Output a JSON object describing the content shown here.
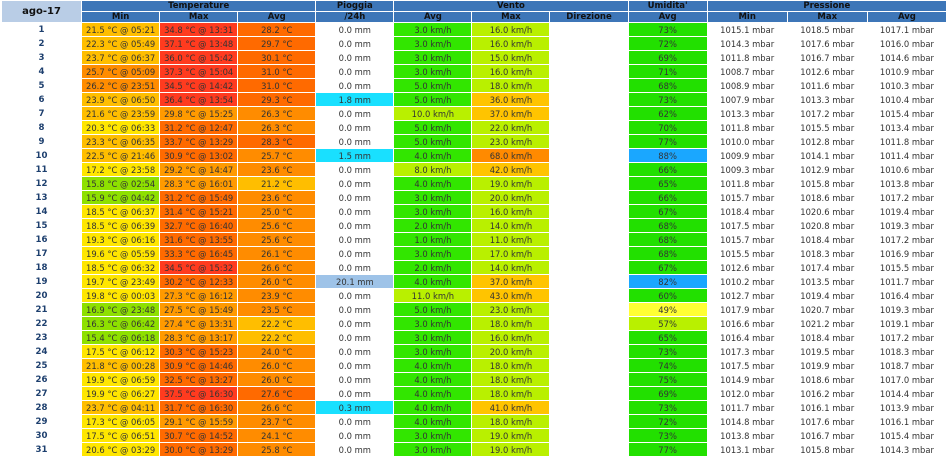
{
  "header": {
    "month": "ago-17",
    "groups": {
      "temperature": "Temperature",
      "rain": "Pioggia",
      "wind": "Vento",
      "humidity": "Umidita'",
      "pressure": "Pressione"
    },
    "sub": {
      "t_min": "Min",
      "t_max": "Max",
      "t_avg": "Avg",
      "rain": "/24h",
      "w_avg": "Avg",
      "w_max": "Max",
      "w_dir": "Direzione",
      "h_avg": "Avg",
      "p_min": "Min",
      "p_max": "Max",
      "p_avg": "Avg"
    }
  },
  "rows": [
    {
      "day": "1",
      "tmin": "21.5 °C @ 05:21",
      "tmax": "34.8 °C @ 13:31",
      "tavg": "28.2 °C",
      "rain": "0.0 mm",
      "wavg": "3.0 km/h",
      "wmax": "16.0 km/h",
      "wdir": "",
      "hum": "73%",
      "pmin": "1015.1 mbar",
      "pmax": "1018.5 mbar",
      "pavg": "1017.1 mbar"
    },
    {
      "day": "2",
      "tmin": "22.3 °C @ 05:49",
      "tmax": "37.1 °C @ 13:48",
      "tavg": "29.7 °C",
      "rain": "0.0 mm",
      "wavg": "3.0 km/h",
      "wmax": "16.0 km/h",
      "wdir": "",
      "hum": "72%",
      "pmin": "1014.3 mbar",
      "pmax": "1017.6 mbar",
      "pavg": "1016.0 mbar"
    },
    {
      "day": "3",
      "tmin": "23.7 °C @ 06:37",
      "tmax": "36.0 °C @ 15:42",
      "tavg": "30.1 °C",
      "rain": "0.0 mm",
      "wavg": "3.0 km/h",
      "wmax": "15.0 km/h",
      "wdir": "",
      "hum": "69%",
      "pmin": "1011.8 mbar",
      "pmax": "1016.7 mbar",
      "pavg": "1014.6 mbar"
    },
    {
      "day": "4",
      "tmin": "25.7 °C @ 05:09",
      "tmax": "37.3 °C @ 15:04",
      "tavg": "31.0 °C",
      "rain": "0.0 mm",
      "wavg": "3.0 km/h",
      "wmax": "16.0 km/h",
      "wdir": "",
      "hum": "71%",
      "pmin": "1008.7 mbar",
      "pmax": "1012.6 mbar",
      "pavg": "1010.9 mbar"
    },
    {
      "day": "5",
      "tmin": "26.2 °C @ 23:51",
      "tmax": "34.5 °C @ 14:42",
      "tavg": "31.0 °C",
      "rain": "0.0 mm",
      "wavg": "5.0 km/h",
      "wmax": "18.0 km/h",
      "wdir": "",
      "hum": "68%",
      "pmin": "1008.9 mbar",
      "pmax": "1011.6 mbar",
      "pavg": "1010.3 mbar"
    },
    {
      "day": "6",
      "tmin": "23.9 °C @ 06:50",
      "tmax": "36.4 °C @ 13:54",
      "tavg": "29.3 °C",
      "rain": "1.8 mm",
      "wavg": "5.0 km/h",
      "wmax": "36.0 km/h",
      "wdir": "",
      "hum": "73%",
      "pmin": "1007.9 mbar",
      "pmax": "1013.3 mbar",
      "pavg": "1010.4 mbar"
    },
    {
      "day": "7",
      "tmin": "21.6 °C @ 23:59",
      "tmax": "29.8 °C @ 15:25",
      "tavg": "26.3 °C",
      "rain": "0.0 mm",
      "wavg": "10.0 km/h",
      "wmax": "37.0 km/h",
      "wdir": "",
      "hum": "62%",
      "pmin": "1013.3 mbar",
      "pmax": "1017.2 mbar",
      "pavg": "1015.4 mbar"
    },
    {
      "day": "8",
      "tmin": "20.3 °C @ 06:33",
      "tmax": "31.2 °C @ 12:47",
      "tavg": "26.3 °C",
      "rain": "0.0 mm",
      "wavg": "5.0 km/h",
      "wmax": "22.0 km/h",
      "wdir": "",
      "hum": "70%",
      "pmin": "1011.8 mbar",
      "pmax": "1015.5 mbar",
      "pavg": "1013.4 mbar"
    },
    {
      "day": "9",
      "tmin": "23.3 °C @ 06:35",
      "tmax": "33.7 °C @ 13:29",
      "tavg": "28.3 °C",
      "rain": "0.0 mm",
      "wavg": "5.0 km/h",
      "wmax": "23.0 km/h",
      "wdir": "",
      "hum": "77%",
      "pmin": "1010.0 mbar",
      "pmax": "1012.8 mbar",
      "pavg": "1011.8 mbar"
    },
    {
      "day": "10",
      "tmin": "22.5 °C @ 21:46",
      "tmax": "30.9 °C @ 13:02",
      "tavg": "25.7 °C",
      "rain": "1.5 mm",
      "wavg": "4.0 km/h",
      "wmax": "68.0 km/h",
      "wdir": "",
      "hum": "88%",
      "pmin": "1009.9 mbar",
      "pmax": "1014.1 mbar",
      "pavg": "1011.4 mbar"
    },
    {
      "day": "11",
      "tmin": "17.2 °C @ 23:58",
      "tmax": "29.2 °C @ 14:47",
      "tavg": "23.6 °C",
      "rain": "0.0 mm",
      "wavg": "8.0 km/h",
      "wmax": "42.0 km/h",
      "wdir": "",
      "hum": "66%",
      "pmin": "1009.3 mbar",
      "pmax": "1012.9 mbar",
      "pavg": "1010.6 mbar"
    },
    {
      "day": "12",
      "tmin": "15.8 °C @ 02:54",
      "tmax": "28.3 °C @ 16:01",
      "tavg": "21.2 °C",
      "rain": "0.0 mm",
      "wavg": "4.0 km/h",
      "wmax": "19.0 km/h",
      "wdir": "",
      "hum": "65%",
      "pmin": "1011.8 mbar",
      "pmax": "1015.8 mbar",
      "pavg": "1013.8 mbar"
    },
    {
      "day": "13",
      "tmin": "15.9 °C @ 04:42",
      "tmax": "31.2 °C @ 15:49",
      "tavg": "23.6 °C",
      "rain": "0.0 mm",
      "wavg": "3.0 km/h",
      "wmax": "20.0 km/h",
      "wdir": "",
      "hum": "66%",
      "pmin": "1015.7 mbar",
      "pmax": "1018.6 mbar",
      "pavg": "1017.2 mbar"
    },
    {
      "day": "14",
      "tmin": "18.5 °C @ 06:37",
      "tmax": "31.4 °C @ 15:21",
      "tavg": "25.0 °C",
      "rain": "0.0 mm",
      "wavg": "3.0 km/h",
      "wmax": "16.0 km/h",
      "wdir": "",
      "hum": "67%",
      "pmin": "1018.4 mbar",
      "pmax": "1020.6 mbar",
      "pavg": "1019.4 mbar"
    },
    {
      "day": "15",
      "tmin": "18.5 °C @ 06:39",
      "tmax": "32.7 °C @ 16:40",
      "tavg": "25.6 °C",
      "rain": "0.0 mm",
      "wavg": "2.0 km/h",
      "wmax": "14.0 km/h",
      "wdir": "",
      "hum": "68%",
      "pmin": "1017.5 mbar",
      "pmax": "1020.8 mbar",
      "pavg": "1019.3 mbar"
    },
    {
      "day": "16",
      "tmin": "19.3 °C @ 06:16",
      "tmax": "31.6 °C @ 13:55",
      "tavg": "25.6 °C",
      "rain": "0.0 mm",
      "wavg": "1.0 km/h",
      "wmax": "11.0 km/h",
      "wdir": "",
      "hum": "68%",
      "pmin": "1015.7 mbar",
      "pmax": "1018.4 mbar",
      "pavg": "1017.2 mbar"
    },
    {
      "day": "17",
      "tmin": "19.6 °C @ 05:59",
      "tmax": "33.3 °C @ 16:45",
      "tavg": "26.1 °C",
      "rain": "0.0 mm",
      "wavg": "3.0 km/h",
      "wmax": "17.0 km/h",
      "wdir": "",
      "hum": "68%",
      "pmin": "1015.5 mbar",
      "pmax": "1018.3 mbar",
      "pavg": "1016.9 mbar"
    },
    {
      "day": "18",
      "tmin": "18.5 °C @ 06:32",
      "tmax": "34.5 °C @ 15:32",
      "tavg": "26.6 °C",
      "rain": "0.0 mm",
      "wavg": "2.0 km/h",
      "wmax": "14.0 km/h",
      "wdir": "",
      "hum": "67%",
      "pmin": "1012.6 mbar",
      "pmax": "1017.4 mbar",
      "pavg": "1015.5 mbar"
    },
    {
      "day": "19",
      "tmin": "19.7 °C @ 23:49",
      "tmax": "30.2 °C @ 12:33",
      "tavg": "26.0 °C",
      "rain": "20.1 mm",
      "wavg": "4.0 km/h",
      "wmax": "37.0 km/h",
      "wdir": "",
      "hum": "82%",
      "pmin": "1010.2 mbar",
      "pmax": "1013.5 mbar",
      "pavg": "1011.7 mbar"
    },
    {
      "day": "20",
      "tmin": "19.8 °C @ 00:03",
      "tmax": "27.3 °C @ 16:12",
      "tavg": "23.9 °C",
      "rain": "0.0 mm",
      "wavg": "11.0 km/h",
      "wmax": "43.0 km/h",
      "wdir": "",
      "hum": "60%",
      "pmin": "1012.7 mbar",
      "pmax": "1019.4 mbar",
      "pavg": "1016.4 mbar"
    },
    {
      "day": "21",
      "tmin": "16.9 °C @ 23:48",
      "tmax": "27.5 °C @ 15:49",
      "tavg": "23.5 °C",
      "rain": "0.0 mm",
      "wavg": "5.0 km/h",
      "wmax": "23.0 km/h",
      "wdir": "",
      "hum": "49%",
      "pmin": "1017.9 mbar",
      "pmax": "1020.7 mbar",
      "pavg": "1019.3 mbar"
    },
    {
      "day": "22",
      "tmin": "16.3 °C @ 06:42",
      "tmax": "27.4 °C @ 13:31",
      "tavg": "22.2 °C",
      "rain": "0.0 mm",
      "wavg": "3.0 km/h",
      "wmax": "18.0 km/h",
      "wdir": "",
      "hum": "57%",
      "pmin": "1016.6 mbar",
      "pmax": "1021.2 mbar",
      "pavg": "1019.1 mbar"
    },
    {
      "day": "23",
      "tmin": "15.4 °C @ 06:18",
      "tmax": "28.3 °C @ 13:17",
      "tavg": "22.2 °C",
      "rain": "0.0 mm",
      "wavg": "3.0 km/h",
      "wmax": "16.0 km/h",
      "wdir": "",
      "hum": "65%",
      "pmin": "1016.4 mbar",
      "pmax": "1018.4 mbar",
      "pavg": "1017.2 mbar"
    },
    {
      "day": "24",
      "tmin": "17.5 °C @ 06:12",
      "tmax": "30.3 °C @ 15:23",
      "tavg": "24.0 °C",
      "rain": "0.0 mm",
      "wavg": "3.0 km/h",
      "wmax": "20.0 km/h",
      "wdir": "",
      "hum": "73%",
      "pmin": "1017.3 mbar",
      "pmax": "1019.5 mbar",
      "pavg": "1018.3 mbar"
    },
    {
      "day": "25",
      "tmin": "21.8 °C @ 00:28",
      "tmax": "30.9 °C @ 14:46",
      "tavg": "26.0 °C",
      "rain": "0.0 mm",
      "wavg": "4.0 km/h",
      "wmax": "18.0 km/h",
      "wdir": "",
      "hum": "74%",
      "pmin": "1017.5 mbar",
      "pmax": "1019.9 mbar",
      "pavg": "1018.7 mbar"
    },
    {
      "day": "26",
      "tmin": "19.9 °C @ 06:59",
      "tmax": "32.5 °C @ 13:27",
      "tavg": "26.0 °C",
      "rain": "0.0 mm",
      "wavg": "4.0 km/h",
      "wmax": "18.0 km/h",
      "wdir": "",
      "hum": "75%",
      "pmin": "1014.9 mbar",
      "pmax": "1018.6 mbar",
      "pavg": "1017.0 mbar"
    },
    {
      "day": "27",
      "tmin": "19.9 °C @ 06:27",
      "tmax": "37.5 °C @ 16:30",
      "tavg": "27.6 °C",
      "rain": "0.0 mm",
      "wavg": "4.0 km/h",
      "wmax": "18.0 km/h",
      "wdir": "",
      "hum": "69%",
      "pmin": "1012.0 mbar",
      "pmax": "1016.2 mbar",
      "pavg": "1014.4 mbar"
    },
    {
      "day": "28",
      "tmin": "23.7 °C @ 04:11",
      "tmax": "31.7 °C @ 16:30",
      "tavg": "26.6 °C",
      "rain": "0.3 mm",
      "wavg": "4.0 km/h",
      "wmax": "41.0 km/h",
      "wdir": "",
      "hum": "73%",
      "pmin": "1011.7 mbar",
      "pmax": "1016.1 mbar",
      "pavg": "1013.9 mbar"
    },
    {
      "day": "29",
      "tmin": "17.3 °C @ 06:05",
      "tmax": "29.1 °C @ 15:59",
      "tavg": "23.7 °C",
      "rain": "0.0 mm",
      "wavg": "4.0 km/h",
      "wmax": "18.0 km/h",
      "wdir": "",
      "hum": "72%",
      "pmin": "1014.8 mbar",
      "pmax": "1017.6 mbar",
      "pavg": "1016.1 mbar"
    },
    {
      "day": "30",
      "tmin": "17.5 °C @ 06:51",
      "tmax": "30.7 °C @ 14:52",
      "tavg": "24.1 °C",
      "rain": "0.0 mm",
      "wavg": "3.0 km/h",
      "wmax": "19.0 km/h",
      "wdir": "",
      "hum": "73%",
      "pmin": "1013.8 mbar",
      "pmax": "1016.7 mbar",
      "pavg": "1015.4 mbar"
    },
    {
      "day": "31",
      "tmin": "20.6 °C @ 03:29",
      "tmax": "30.0 °C @ 13:29",
      "tavg": "25.8 °C",
      "rain": "0.0 mm",
      "wavg": "3.0 km/h",
      "wmax": "19.0 km/h",
      "wdir": "",
      "hum": "77%",
      "pmin": "1013.1 mbar",
      "pmax": "1015.8 mbar",
      "pavg": "1014.3 mbar"
    }
  ],
  "colors": {
    "header_bg": "#3d76b8",
    "month_bg": "#b9cde6",
    "temp_max_scale": [
      "#ffd000",
      "#ff9a00",
      "#ff6a00",
      "#ff3b1f"
    ],
    "temp_cool": "#8ee000",
    "temp_mild": "#ffe600",
    "temp_warm": "#ffbe00",
    "temp_hot": "#ff8c00",
    "rain_light": "#19e0ff",
    "rain_heavy": "#9ec3e8",
    "wind_low": "#32e600",
    "wind_mid": "#b9f000",
    "wind_high": "#ffc400",
    "wind_gust_high": "#ff8a00",
    "humidity_green": "#22e000",
    "humidity_low": "#ffff33",
    "humidity_high": "#1aa7ff"
  }
}
